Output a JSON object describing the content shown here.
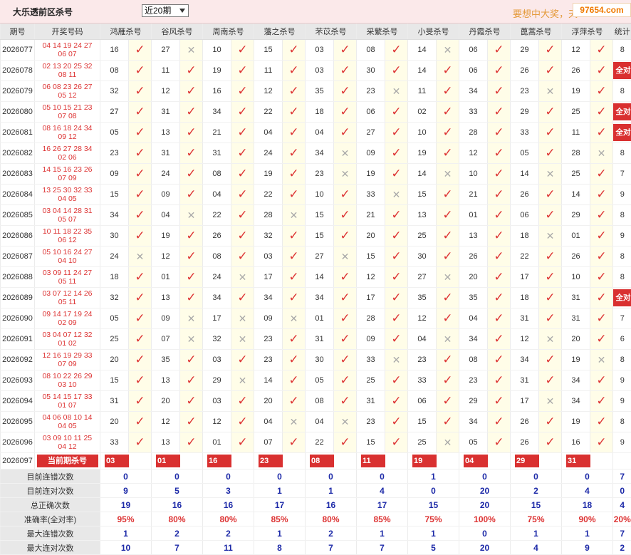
{
  "header": {
    "title": "大乐透前区杀号",
    "period_select": "近20期",
    "slogan": "要想中大奖，天",
    "watermark": "97654.com"
  },
  "columns": {
    "issue": "期号",
    "draw": "开奖号码",
    "experts": [
      "鸿雁杀号",
      "谷风杀号",
      "周南杀号",
      "藩之杀号",
      "芣苡杀号",
      "采蘩杀号",
      "小旻杀号",
      "丹霞杀号",
      "蓖蒿杀号",
      "浮萍杀号"
    ],
    "stat": "统计"
  },
  "rows": [
    {
      "issue": "2026077",
      "draw1": "04 14 19 24 27",
      "draw2": "06 07",
      "kills": [
        "16",
        "27",
        "10",
        "15",
        "03",
        "08",
        "14",
        "06",
        "29",
        "12"
      ],
      "marks": [
        1,
        0,
        1,
        1,
        1,
        1,
        0,
        1,
        1,
        1
      ],
      "stat": "8"
    },
    {
      "issue": "2026078",
      "draw1": "02 13 20 25 32",
      "draw2": "08 11",
      "kills": [
        "08",
        "11",
        "19",
        "11",
        "03",
        "30",
        "14",
        "06",
        "26",
        "26"
      ],
      "marks": [
        1,
        1,
        1,
        1,
        1,
        1,
        1,
        1,
        1,
        1
      ],
      "stat": "全对"
    },
    {
      "issue": "2026079",
      "draw1": "06 08 23 26 27",
      "draw2": "05 12",
      "kills": [
        "32",
        "12",
        "16",
        "12",
        "35",
        "23",
        "11",
        "34",
        "23",
        "19"
      ],
      "marks": [
        1,
        1,
        1,
        1,
        1,
        0,
        1,
        1,
        0,
        1
      ],
      "stat": "8"
    },
    {
      "issue": "2026080",
      "draw1": "05 10 15 21 23",
      "draw2": "07 08",
      "kills": [
        "27",
        "31",
        "34",
        "22",
        "18",
        "06",
        "02",
        "33",
        "29",
        "25"
      ],
      "marks": [
        1,
        1,
        1,
        1,
        1,
        1,
        1,
        1,
        1,
        1
      ],
      "stat": "全对"
    },
    {
      "issue": "2026081",
      "draw1": "08 16 18 24 34",
      "draw2": "09 12",
      "kills": [
        "05",
        "13",
        "21",
        "04",
        "04",
        "27",
        "10",
        "28",
        "33",
        "11"
      ],
      "marks": [
        1,
        1,
        1,
        1,
        1,
        1,
        1,
        1,
        1,
        1
      ],
      "stat": "全对"
    },
    {
      "issue": "2026082",
      "draw1": "16 26 27 28 34",
      "draw2": "02 06",
      "kills": [
        "23",
        "31",
        "31",
        "24",
        "34",
        "09",
        "19",
        "12",
        "05",
        "28"
      ],
      "marks": [
        1,
        1,
        1,
        1,
        0,
        1,
        1,
        1,
        1,
        0
      ],
      "stat": "8"
    },
    {
      "issue": "2026083",
      "draw1": "14 15 16 23 26",
      "draw2": "07 09",
      "kills": [
        "09",
        "24",
        "08",
        "19",
        "23",
        "19",
        "14",
        "10",
        "14",
        "25"
      ],
      "marks": [
        1,
        1,
        1,
        1,
        0,
        1,
        0,
        1,
        0,
        1
      ],
      "stat": "7"
    },
    {
      "issue": "2026084",
      "draw1": "13 25 30 32 33",
      "draw2": "04 05",
      "kills": [
        "15",
        "09",
        "04",
        "22",
        "10",
        "33",
        "15",
        "21",
        "26",
        "14"
      ],
      "marks": [
        1,
        1,
        1,
        1,
        1,
        0,
        1,
        1,
        1,
        1
      ],
      "stat": "9"
    },
    {
      "issue": "2026085",
      "draw1": "03 04 14 28 31",
      "draw2": "05 07",
      "kills": [
        "34",
        "04",
        "22",
        "28",
        "15",
        "21",
        "13",
        "01",
        "06",
        "29"
      ],
      "marks": [
        1,
        0,
        1,
        0,
        1,
        1,
        1,
        1,
        1,
        1
      ],
      "stat": "8"
    },
    {
      "issue": "2026086",
      "draw1": "10 11 18 22 35",
      "draw2": "06 12",
      "kills": [
        "30",
        "19",
        "26",
        "32",
        "15",
        "20",
        "25",
        "13",
        "18",
        "01"
      ],
      "marks": [
        1,
        1,
        1,
        1,
        1,
        1,
        1,
        1,
        0,
        1
      ],
      "stat": "9"
    },
    {
      "issue": "2026087",
      "draw1": "05 10 16 24 27",
      "draw2": "04 10",
      "kills": [
        "24",
        "12",
        "08",
        "03",
        "27",
        "15",
        "30",
        "26",
        "22",
        "26"
      ],
      "marks": [
        0,
        1,
        1,
        1,
        0,
        1,
        1,
        1,
        1,
        1
      ],
      "stat": "8"
    },
    {
      "issue": "2026088",
      "draw1": "03 09 11 24 27",
      "draw2": "05 11",
      "kills": [
        "18",
        "01",
        "24",
        "17",
        "14",
        "12",
        "27",
        "20",
        "17",
        "10"
      ],
      "marks": [
        1,
        1,
        0,
        1,
        1,
        1,
        0,
        1,
        1,
        1
      ],
      "stat": "8"
    },
    {
      "issue": "2026089",
      "draw1": "03 07 12 14 26",
      "draw2": "05 11",
      "kills": [
        "32",
        "13",
        "34",
        "34",
        "34",
        "17",
        "35",
        "35",
        "18",
        "31"
      ],
      "marks": [
        1,
        1,
        1,
        1,
        1,
        1,
        1,
        1,
        1,
        1
      ],
      "stat": "全对"
    },
    {
      "issue": "2026090",
      "draw1": "09 14 17 19 24",
      "draw2": "02 09",
      "kills": [
        "05",
        "09",
        "17",
        "09",
        "01",
        "28",
        "12",
        "04",
        "31",
        "31"
      ],
      "marks": [
        1,
        0,
        0,
        0,
        1,
        1,
        1,
        1,
        1,
        1
      ],
      "stat": "7"
    },
    {
      "issue": "2026091",
      "draw1": "03 04 07 12 32",
      "draw2": "01 02",
      "kills": [
        "25",
        "07",
        "32",
        "23",
        "31",
        "09",
        "04",
        "34",
        "12",
        "20"
      ],
      "marks": [
        1,
        0,
        0,
        1,
        1,
        1,
        0,
        1,
        0,
        1
      ],
      "stat": "6"
    },
    {
      "issue": "2026092",
      "draw1": "12 16 19 29 33",
      "draw2": "07 09",
      "kills": [
        "20",
        "35",
        "03",
        "23",
        "30",
        "33",
        "23",
        "08",
        "34",
        "19"
      ],
      "marks": [
        1,
        1,
        1,
        1,
        1,
        0,
        1,
        1,
        1,
        0
      ],
      "stat": "8"
    },
    {
      "issue": "2026093",
      "draw1": "08 10 22 26 29",
      "draw2": "03 10",
      "kills": [
        "15",
        "13",
        "29",
        "14",
        "05",
        "25",
        "33",
        "23",
        "31",
        "34"
      ],
      "marks": [
        1,
        1,
        0,
        1,
        1,
        1,
        1,
        1,
        1,
        1
      ],
      "stat": "9"
    },
    {
      "issue": "2026094",
      "draw1": "05 14 15 17 33",
      "draw2": "01 07",
      "kills": [
        "31",
        "20",
        "03",
        "20",
        "08",
        "31",
        "06",
        "29",
        "17",
        "34"
      ],
      "marks": [
        1,
        1,
        1,
        1,
        1,
        1,
        1,
        1,
        0,
        1
      ],
      "stat": "9"
    },
    {
      "issue": "2026095",
      "draw1": "04 06 08 10 14",
      "draw2": "04 05",
      "kills": [
        "20",
        "12",
        "12",
        "04",
        "04",
        "23",
        "15",
        "34",
        "26",
        "19"
      ],
      "marks": [
        1,
        1,
        1,
        0,
        0,
        1,
        1,
        1,
        1,
        1
      ],
      "stat": "8"
    },
    {
      "issue": "2026096",
      "draw1": "03 09 10 11 25",
      "draw2": "04 12",
      "kills": [
        "33",
        "13",
        "01",
        "07",
        "22",
        "15",
        "25",
        "05",
        "26",
        "16"
      ],
      "marks": [
        1,
        1,
        1,
        1,
        1,
        1,
        0,
        1,
        1,
        1
      ],
      "stat": "9"
    }
  ],
  "current": {
    "issue": "2026097",
    "label": "当前期杀号",
    "kills": [
      "03",
      "01",
      "16",
      "23",
      "08",
      "11",
      "19",
      "04",
      "29",
      "31"
    ]
  },
  "summary": [
    {
      "label": "目前连错次数",
      "values": [
        "0",
        "0",
        "0",
        "0",
        "0",
        "0",
        "1",
        "0",
        "0",
        "0"
      ],
      "stat": "7",
      "kind": "val"
    },
    {
      "label": "目前连对次数",
      "values": [
        "9",
        "5",
        "3",
        "1",
        "1",
        "4",
        "0",
        "20",
        "2",
        "4"
      ],
      "stat": "0",
      "kind": "val"
    },
    {
      "label": "总正确次数",
      "values": [
        "19",
        "16",
        "16",
        "17",
        "16",
        "17",
        "15",
        "20",
        "15",
        "18"
      ],
      "stat": "4",
      "kind": "val"
    },
    {
      "label": "准确率(全对率)",
      "values": [
        "95%",
        "80%",
        "80%",
        "85%",
        "80%",
        "85%",
        "75%",
        "100%",
        "75%",
        "90%"
      ],
      "stat": "20%",
      "kind": "rate"
    },
    {
      "label": "最大连错次数",
      "values": [
        "1",
        "2",
        "2",
        "1",
        "2",
        "1",
        "1",
        "0",
        "1",
        "1"
      ],
      "stat": "7",
      "kind": "val"
    },
    {
      "label": "最大连对次数",
      "values": [
        "10",
        "7",
        "11",
        "8",
        "7",
        "7",
        "5",
        "20",
        "4",
        "9"
      ],
      "stat": "2",
      "kind": "val"
    }
  ],
  "icons": {
    "correct": "check-icon",
    "wrong": "cross-icon"
  },
  "colors": {
    "accent": "#d93030",
    "header_bg": "#e8e8e8",
    "top_bg": "#fbe9ea",
    "summary_text": "#1d2aa8"
  }
}
